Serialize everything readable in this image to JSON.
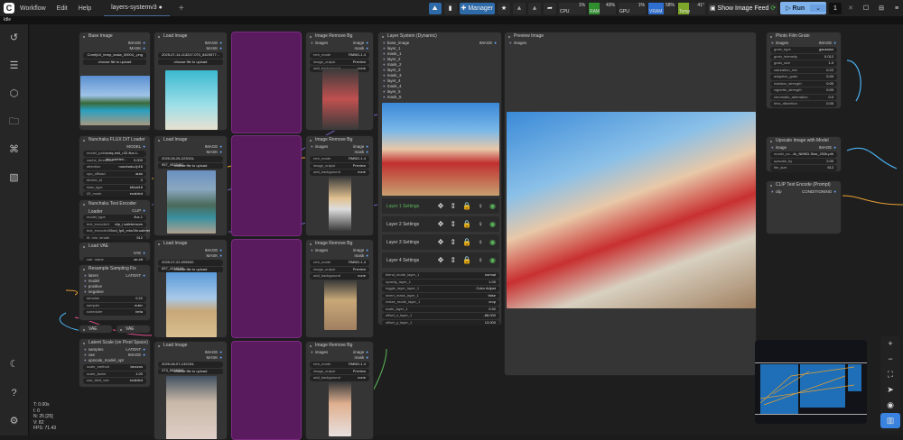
{
  "topbar": {
    "logo": "C",
    "menus": [
      "Workflow",
      "Edit",
      "Help"
    ],
    "tab": "layers-systemv3",
    "tab_dirty": "●",
    "new_tab": "+",
    "manager": "Manager",
    "monitors": [
      {
        "label": "CPU",
        "pct": "1%",
        "value": 1,
        "color": "#2b2b2b"
      },
      {
        "label": "RAM",
        "pct": "43%",
        "value": 43,
        "color": "#2f8f2f"
      },
      {
        "label": "GPU",
        "pct": "1%",
        "value": 1,
        "color": "#2b2b2b"
      },
      {
        "label": "VRAM",
        "pct": "58%",
        "value": 58,
        "color": "#2f6fd0"
      },
      {
        "label": "Temp",
        "pct": "41°",
        "value": 41,
        "color": "#7ea62a"
      }
    ],
    "show_feed": "Show Image Feed",
    "run": "Run",
    "queue_count": "1"
  },
  "status": "Idle",
  "stats": {
    "t": "T: 0.00s",
    "i": "I: 0",
    "n": "N: 25 [25]",
    "v": "V: 82",
    "fps": "FPS: 71.43"
  },
  "nodes": {
    "base_image": {
      "title": "Base Image",
      "outputs": [
        "IMAGE",
        "MASK"
      ],
      "widgets": [
        [
          "",
          "ComfyUI_temp_kxsia_00004_.png"
        ]
      ],
      "button": "choose file to upload"
    },
    "load1": {
      "title": "Load Image",
      "outputs": [
        "IMAGE",
        "MASK"
      ],
      "widgets": [
        [
          "",
          "2025-07-14-113247-070_8420577..."
        ]
      ],
      "button": "choose file to upload"
    },
    "load2": {
      "title": "Load Image",
      "outputs": [
        "IMAGE",
        "MASK"
      ],
      "widgets": [
        [
          "",
          "2025-06-26-223024-957_4532481..."
        ]
      ],
      "button": "choose file to upload"
    },
    "load3": {
      "title": "Load Image",
      "outputs": [
        "IMAGE",
        "MASK"
      ],
      "widgets": [
        [
          "",
          "2025-07-22-005502-657_4249108..."
        ]
      ],
      "button": "choose file to upload"
    },
    "load4": {
      "title": "Load Image",
      "outputs": [
        "IMAGE",
        "MASK"
      ],
      "widgets": [
        [
          "",
          "2025-06-07-132204-473_5688568..."
        ]
      ],
      "button": "choose file to upload"
    },
    "dit": {
      "title": "Nunchaku FLUX DiT Loader",
      "outputs": [
        "MODEL"
      ],
      "widgets": [
        [
          "model_path",
          "svdq-int4_r32-flux.1-dev.safeten..."
        ],
        [
          "cache_threshold",
          "0.000"
        ],
        [
          "attention",
          "nunchaku-fp16"
        ],
        [
          "cpu_offload",
          "auto"
        ],
        [
          "device_id",
          "0"
        ],
        [
          "data_type",
          "bfloat16"
        ],
        [
          "i2f_mode",
          "enabled"
        ]
      ]
    },
    "te": {
      "title": "Nunchaku Text Encoder Loader",
      "outputs": [
        "CLIP"
      ],
      "widgets": [
        [
          "model_type",
          "flux.1"
        ],
        [
          "text_encoder1",
          "clip_l.safetensors"
        ],
        [
          "text_encoder2",
          "t5xxl_fp8_e4m3fn.safetensors"
        ],
        [
          "t5_min_length",
          "512"
        ]
      ]
    },
    "vae": {
      "title": "Load VAE",
      "outputs": [
        "VAE"
      ],
      "widgets": [
        [
          "vae_name",
          "ae.sft"
        ]
      ]
    },
    "resample": {
      "title": "Resample Sampling Fix",
      "inputs": [
        "latent",
        "model",
        "positive",
        "negative"
      ],
      "outputs": [
        "LATENT"
      ],
      "widgets": [
        [
          "denoise",
          "0.22"
        ],
        [
          "sampler",
          "euler"
        ],
        [
          "scheduler",
          "beta"
        ]
      ]
    },
    "vaeenc": {
      "title": "VAE Encode"
    },
    "vaedec": {
      "title": "VAE Decode"
    },
    "latscale": {
      "title": "Latent Scale (on Pixel Space)",
      "inputs": [
        "samples",
        "vae",
        "upscale_model_opt"
      ],
      "outputs": [
        "LATENT",
        "IMAGE"
      ],
      "widgets": [
        [
          "scale_method",
          "lanczos"
        ],
        [
          "scale_factor",
          "1.00"
        ],
        [
          "use_tiled_vae",
          "enabled"
        ]
      ]
    },
    "rmbg1": {
      "title": "Image Remove Bg",
      "inputs": [
        "images"
      ],
      "outputs": [
        "image",
        "mask"
      ],
      "widgets": [
        [
          "rem_mode",
          "RMBG-1.4"
        ],
        [
          "image_output",
          "Preview"
        ],
        [
          "add_background",
          "none"
        ]
      ]
    },
    "rmbg2": {
      "title": "Image Remove Bg",
      "inputs": [
        "images"
      ],
      "outputs": [
        "image",
        "mask"
      ],
      "widgets": [
        [
          "rem_mode",
          "RMBG-1.4"
        ],
        [
          "image_output",
          "Preview"
        ],
        [
          "add_background",
          "none"
        ]
      ]
    },
    "rmbg3": {
      "title": "Image Remove Bg",
      "inputs": [
        "images"
      ],
      "outputs": [
        "image",
        "mask"
      ],
      "widgets": [
        [
          "rem_mode",
          "RMBG-1.4"
        ],
        [
          "image_output",
          "Preview"
        ],
        [
          "add_background",
          "none"
        ]
      ]
    },
    "rmbg4": {
      "title": "Image Remove Bg",
      "inputs": [
        "images"
      ],
      "outputs": [
        "image",
        "mask"
      ],
      "widgets": [
        [
          "rem_mode",
          "RMBG-1.4"
        ],
        [
          "image_output",
          "Preview"
        ],
        [
          "add_background",
          "none"
        ]
      ]
    },
    "layers": {
      "title": "Layer System (Dynamic)",
      "inputs": [
        "base_image",
        "layer_1",
        "mask_1",
        "layer_2",
        "mask_2",
        "layer_3",
        "mask_3",
        "layer_4",
        "mask_4",
        "layer_5",
        "mask_5"
      ],
      "outputs": [
        "IMAGE"
      ]
    },
    "preview": {
      "title": "Preview Image",
      "inputs": [
        "images"
      ]
    },
    "grain": {
      "title": "Photo Film Grain",
      "inputs": [
        "images"
      ],
      "outputs": [
        "IMAGE"
      ],
      "widgets": [
        [
          "grain_type",
          "gaussian"
        ],
        [
          "grain_intensity",
          "0.012"
        ],
        [
          "grain_size",
          "1.0"
        ],
        [
          "saturation_mix",
          "0.22"
        ],
        [
          "adaptive_grain",
          "0.00"
        ],
        [
          "halation_strength",
          "0.00"
        ],
        [
          "vignette_strength",
          "0.00"
        ],
        [
          "chromatic_aberration",
          "0.0"
        ],
        [
          "lens_distortion",
          "0.00"
        ]
      ]
    },
    "upscale": {
      "title": "Upscale Image with Model",
      "inputs": [
        "image"
      ],
      "outputs": [
        "IMAGE"
      ],
      "widgets": [
        [
          "model_na...",
          "4x_NMKD-Siax_200k.pth"
        ],
        [
          "upscale_by",
          "2.00"
        ],
        [
          "tile_size",
          "512"
        ]
      ]
    },
    "clip": {
      "title": "CLIP Text Encode (Prompt)",
      "inputs": [
        "clip"
      ],
      "outputs": [
        "CONDITIONING"
      ]
    }
  },
  "layer_settings": [
    "Layer 1 Settings",
    "Layer 2 Settings",
    "Layer 3 Settings",
    "Layer 4 Settings"
  ],
  "layer_widgets": [
    [
      "blend_mode_layer_1",
      "normal"
    ],
    [
      "opacity_layer_1",
      "1.00"
    ],
    [
      "toggle_layer_layer_1",
      "Color Adjust"
    ],
    [
      "invert_mask_layer_1",
      "false"
    ],
    [
      "resize_mode_layer_1",
      "crop"
    ],
    [
      "scale_layer_1",
      "0.92"
    ],
    [
      "offset_x_layer_1",
      "-88.000"
    ],
    [
      "offset_y_layer_1",
      "13.000"
    ]
  ]
}
